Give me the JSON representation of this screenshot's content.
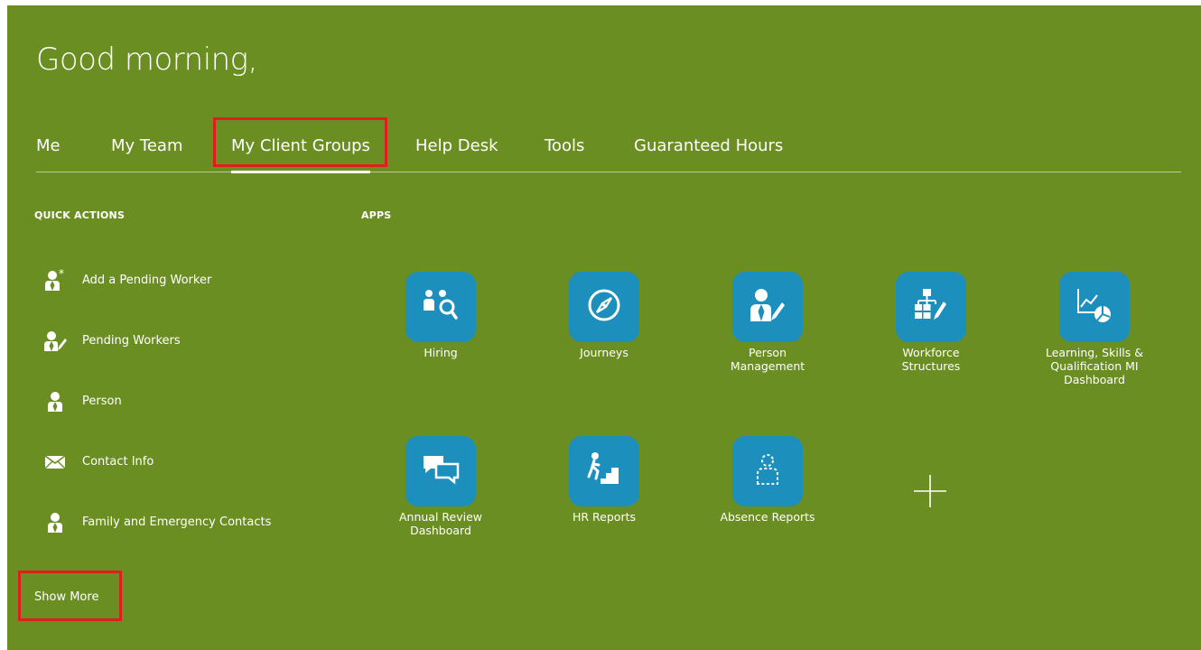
{
  "header": {
    "greeting": "Good morning,"
  },
  "tabs": [
    {
      "label": "Me"
    },
    {
      "label": "My Team"
    },
    {
      "label": "My Client Groups"
    },
    {
      "label": "Help Desk"
    },
    {
      "label": "Tools"
    },
    {
      "label": "Guaranteed Hours"
    }
  ],
  "active_tab": "My Client Groups",
  "quick_actions": {
    "title": "QUICK ACTIONS",
    "items": [
      {
        "label": "Add a Pending Worker",
        "icon": "add-person-icon"
      },
      {
        "label": "Pending Workers",
        "icon": "person-edit-icon"
      },
      {
        "label": "Person",
        "icon": "person-icon"
      },
      {
        "label": "Contact Info",
        "icon": "envelope-icon"
      },
      {
        "label": "Family and Emergency Contacts",
        "icon": "person-icon"
      }
    ],
    "show_more": "Show More"
  },
  "apps": {
    "title": "APPS",
    "items": [
      {
        "label": "Hiring",
        "icon": "hiring-icon"
      },
      {
        "label": "Journeys",
        "icon": "compass-icon"
      },
      {
        "label": "Person\nManagement",
        "icon": "person-edit-icon"
      },
      {
        "label": "Workforce\nStructures",
        "icon": "org-chart-icon"
      },
      {
        "label": "Learning, Skills &\nQualification MI\nDashboard",
        "icon": "analytics-icon"
      },
      {
        "label": "Annual Review\nDashboard",
        "icon": "chat-bubbles-icon"
      },
      {
        "label": "HR Reports",
        "icon": "stairs-icon"
      },
      {
        "label": "Absence Reports",
        "icon": "absent-person-icon"
      }
    ],
    "add_icon": "plus-icon"
  },
  "colors": {
    "background": "#6b8e23",
    "tile": "#1c8fbd",
    "highlight": "#e01e1e",
    "text": "#ffffff"
  }
}
